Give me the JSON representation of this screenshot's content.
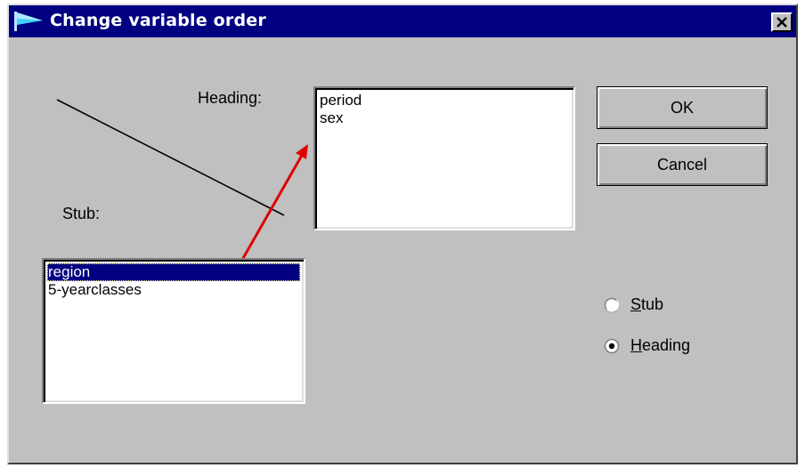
{
  "window": {
    "title": "Change variable order",
    "close_glyph": "✕",
    "icon": "flag-icon"
  },
  "labels": {
    "heading": "Heading:",
    "stub": "Stub:"
  },
  "heading_list": {
    "items": [
      "period",
      "sex"
    ]
  },
  "stub_list": {
    "items": [
      "region",
      "5-yearclasses"
    ],
    "selected": "region"
  },
  "buttons": {
    "ok": "OK",
    "cancel": "Cancel"
  },
  "radios": {
    "stub": {
      "first": "S",
      "rest": "tub",
      "checked": false
    },
    "heading": {
      "first": "H",
      "rest": "eading",
      "checked": true
    }
  },
  "colors": {
    "title_bar": "#000080",
    "dialog_bg": "#c0c0c0",
    "selection": "#000080",
    "arrow": "#e00000"
  }
}
